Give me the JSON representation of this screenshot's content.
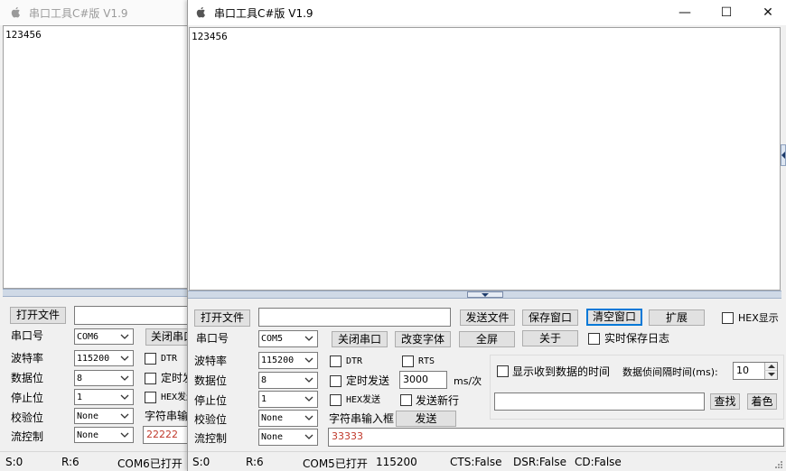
{
  "back_window": {
    "title": "串口工具C#版  V1.9",
    "receive_text": "123456",
    "open_file_label": "打开文件",
    "port_label": "串口号",
    "port_value": "COM6",
    "close_port_label": "关闭串口",
    "baud_label": "波特率",
    "baud_value": "115200",
    "data_bits_label": "数据位",
    "data_bits_value": "8",
    "stop_bits_label": "停止位",
    "stop_bits_value": "1",
    "parity_label": "校验位",
    "parity_value": "None",
    "flow_label": "流控制",
    "flow_value": "None",
    "dtr_label": "DTR",
    "timed_send_label": "定时发送",
    "hex_send_label": "HEX发送",
    "input_box_label": "字符串输入框",
    "send_text": "22222",
    "status": {
      "sent": "S:0",
      "received": "R:6",
      "port_state": "COM6已打开"
    }
  },
  "front_window": {
    "title": "串口工具C#版  V1.9",
    "caption": {
      "minimize": "—",
      "maximize": "☐",
      "close": "✕"
    },
    "receive_text": "123456",
    "toolbar": {
      "open_file": "打开文件",
      "file_path": "",
      "send_file": "发送文件",
      "save_window": "保存窗口",
      "clear_window": "清空窗口",
      "expand": "扩展",
      "hex_display": "HEX显示"
    },
    "port": {
      "port_label": "串口号",
      "port_value": "COM5",
      "close_port": "关闭串口",
      "change_font": "改变字体",
      "fullscreen": "全屏",
      "about": "关于",
      "realtime_log": "实时保存日志"
    },
    "settings": {
      "baud_label": "波特率",
      "baud_value": "115200",
      "data_bits_label": "数据位",
      "data_bits_value": "8",
      "stop_bits_label": "停止位",
      "stop_bits_value": "1",
      "parity_label": "校验位",
      "parity_value": "None",
      "flow_label": "流控制",
      "flow_value": "None"
    },
    "send": {
      "dtr": "DTR",
      "rts": "RTS",
      "timed_send": "定时发送",
      "interval_value": "3000",
      "interval_unit": "ms/次",
      "hex_send": "HEX发送",
      "send_newline": "发送新行",
      "input_box_label": "字符串输入框",
      "send_button": "发送",
      "send_text": "33333"
    },
    "extra": {
      "show_time_label": "显示收到数据的时间",
      "frame_interval_label": "数据侦间隔时间(ms):",
      "frame_interval_value": "10",
      "search_text": "",
      "find_button": "查找",
      "color_button": "着色"
    },
    "status": {
      "sent": "S:0",
      "received": "R:6",
      "port_state": "COM5已打开",
      "baud": "115200",
      "cts": "CTS:False",
      "dsr": "DSR:False",
      "cd": "CD:False"
    }
  }
}
